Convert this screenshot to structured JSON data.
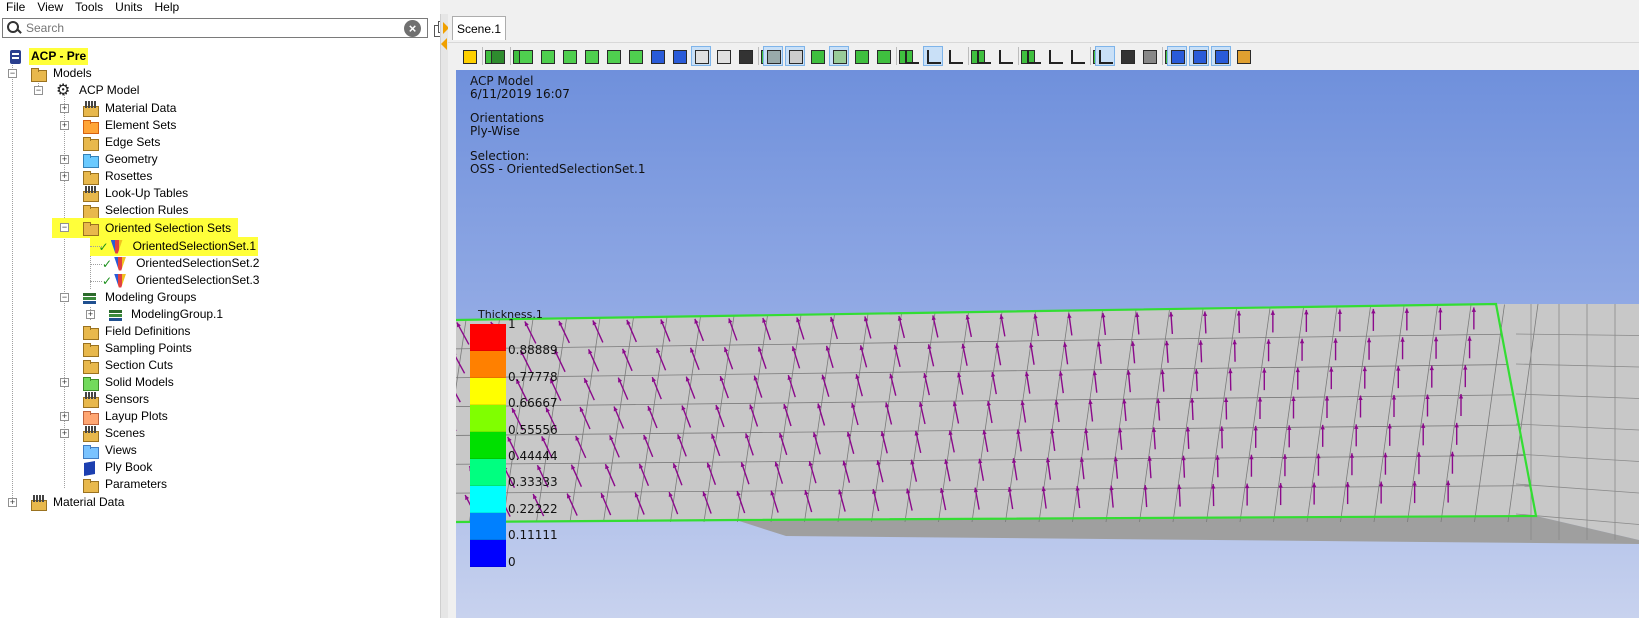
{
  "menu": [
    "File",
    "View",
    "Tools",
    "Units",
    "Help"
  ],
  "search": {
    "placeholder": "Search"
  },
  "tree": {
    "root": "ACP - Pre",
    "models": "Models",
    "acp_model": "ACP Model",
    "items": [
      {
        "label": "Material Data",
        "icon": "material-data-icon"
      },
      {
        "label": "Element Sets",
        "icon": "element-sets-icon"
      },
      {
        "label": "Edge Sets",
        "icon": "edge-sets-icon"
      },
      {
        "label": "Geometry",
        "icon": "geometry-icon"
      },
      {
        "label": "Rosettes",
        "icon": "rosettes-icon"
      },
      {
        "label": "Look-Up Tables",
        "icon": "lookup-tables-icon"
      },
      {
        "label": "Selection Rules",
        "icon": "selection-rules-icon"
      },
      {
        "label": "Oriented Selection Sets",
        "icon": "oriented-selection-sets-icon"
      }
    ],
    "oss": [
      "OrientedSelectionSet.1",
      "OrientedSelectionSet.2",
      "OrientedSelectionSet.3"
    ],
    "items2": [
      {
        "label": "Modeling Groups",
        "icon": "modeling-groups-icon"
      }
    ],
    "modeling_group": "ModelingGroup.1",
    "items3": [
      {
        "label": "Field Definitions",
        "icon": "field-definitions-icon"
      },
      {
        "label": "Sampling Points",
        "icon": "sampling-points-icon"
      },
      {
        "label": "Section Cuts",
        "icon": "section-cuts-icon"
      },
      {
        "label": "Solid Models",
        "icon": "solid-models-icon"
      },
      {
        "label": "Sensors",
        "icon": "sensors-icon"
      },
      {
        "label": "Layup Plots",
        "icon": "layup-plots-icon"
      },
      {
        "label": "Scenes",
        "icon": "scenes-icon"
      },
      {
        "label": "Views",
        "icon": "views-icon"
      },
      {
        "label": "Ply Book",
        "icon": "ply-book-icon"
      },
      {
        "label": "Parameters",
        "icon": "parameters-icon"
      }
    ],
    "material_data_root": "Material Data"
  },
  "scene": {
    "tab": "Scene.1",
    "info": {
      "model": "ACP Model",
      "date": "6/11/2019 16:07",
      "orientations": "Orientations",
      "ply_wise": "Ply-Wise",
      "selection": "Selection:",
      "oss": "OSS - OrientedSelectionSet.1"
    },
    "legend": {
      "title": "Thickness.1",
      "labels": [
        "1",
        "0.88889",
        "0.77778",
        "0.66667",
        "0.55556",
        "0.44444",
        "0.33333",
        "0.22222",
        "0.11111",
        "0"
      ],
      "colors": [
        "#ff0000",
        "#ff8000",
        "#ffff00",
        "#80ff00",
        "#00e000",
        "#00ff80",
        "#00ffff",
        "#0080ff",
        "#0000ff"
      ]
    },
    "colors": {
      "mesh": "#c8c8c8",
      "arrow": "#8b0a8b",
      "edge": "#33dd33",
      "highlight": "#ffff3a"
    }
  }
}
